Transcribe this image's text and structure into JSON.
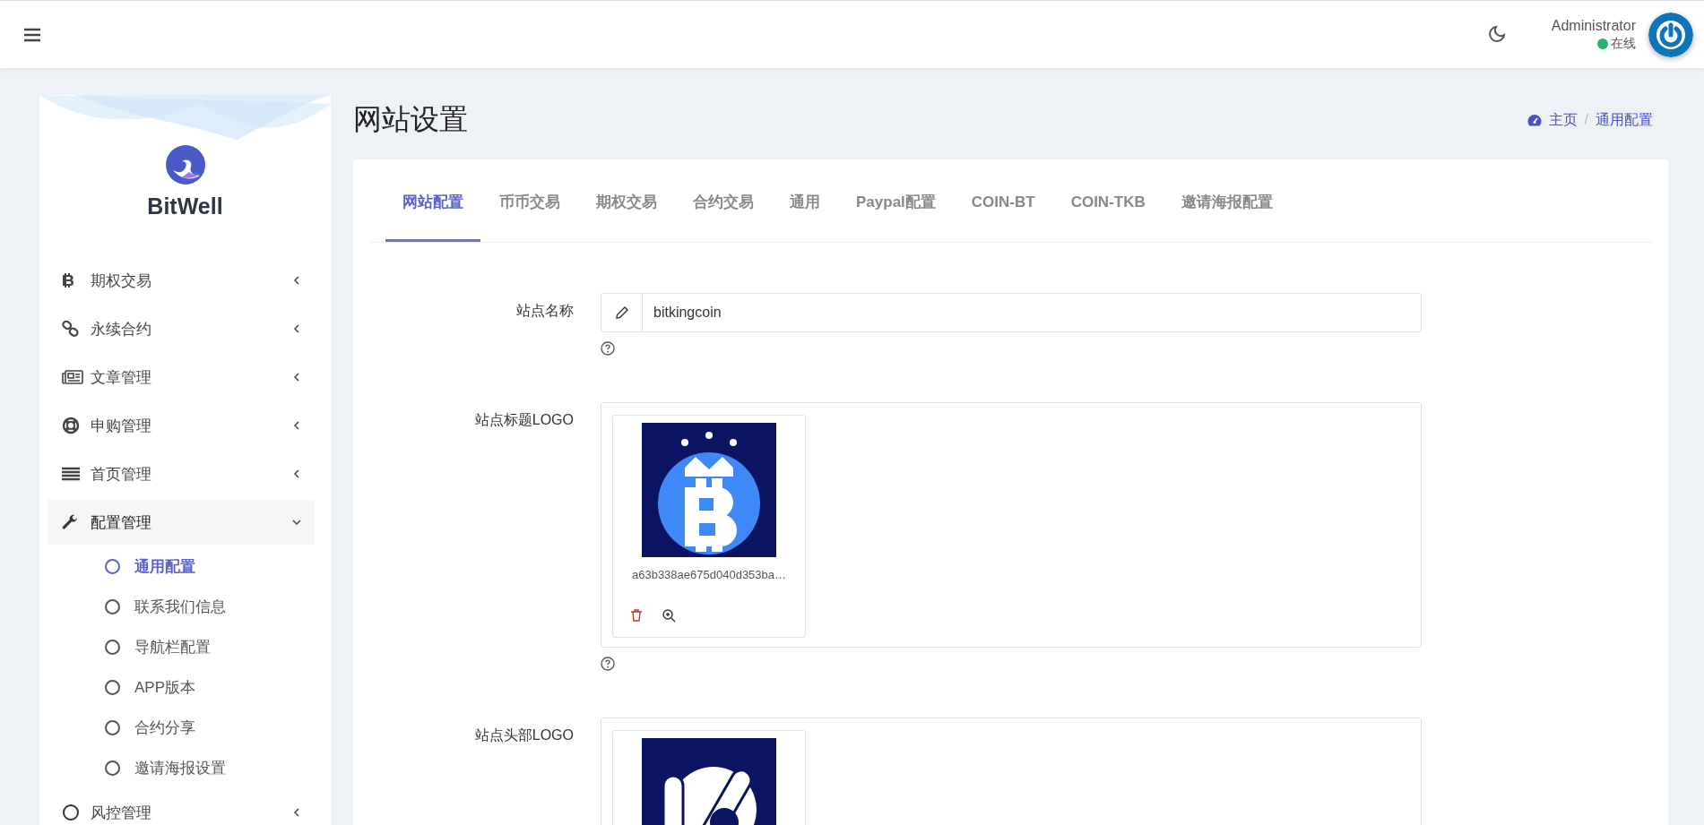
{
  "header": {
    "user": "Administrator",
    "status": "在线"
  },
  "sidebar": {
    "brand": "BitWell",
    "items": [
      {
        "label": "期权交易",
        "kind": "bitcoin",
        "expanded": false
      },
      {
        "label": "永续合约",
        "kind": "link",
        "expanded": false
      },
      {
        "label": "文章管理",
        "kind": "newspaper",
        "expanded": false
      },
      {
        "label": "申购管理",
        "kind": "lifering",
        "expanded": false
      },
      {
        "label": "首页管理",
        "kind": "bars",
        "expanded": false
      },
      {
        "label": "配置管理",
        "kind": "wrench",
        "expanded": true,
        "children": [
          {
            "label": "通用配置",
            "selected": true
          },
          {
            "label": "联系我们信息",
            "selected": false
          },
          {
            "label": "导航栏配置",
            "selected": false
          },
          {
            "label": "APP版本",
            "selected": false
          },
          {
            "label": "合约分享",
            "selected": false
          },
          {
            "label": "邀请海报设置",
            "selected": false
          }
        ]
      },
      {
        "label": "风控管理",
        "kind": "circle",
        "expanded": false
      }
    ]
  },
  "page_title": "网站设置",
  "breadcrumb": [
    "主页",
    "通用配置"
  ],
  "breadcrumb_separator": "/",
  "tabs": [
    {
      "label": "网站配置",
      "selected": true
    },
    {
      "label": "币币交易",
      "selected": false
    },
    {
      "label": "期权交易",
      "selected": false
    },
    {
      "label": "合约交易",
      "selected": false
    },
    {
      "label": "通用",
      "selected": false
    },
    {
      "label": "Paypal配置",
      "selected": false
    },
    {
      "label": "COIN-BT",
      "selected": false
    },
    {
      "label": "COIN-TKB",
      "selected": false
    },
    {
      "label": "邀请海报配置",
      "selected": false
    }
  ],
  "form": [
    {
      "label": "站点名称",
      "kind": "text",
      "value": "bitkingcoin"
    },
    {
      "label": "站点标题LOGO",
      "kind": "upload",
      "file": "a63b338ae675d040d353ba…"
    },
    {
      "label": "站点头部LOGO",
      "kind": "upload"
    }
  ]
}
